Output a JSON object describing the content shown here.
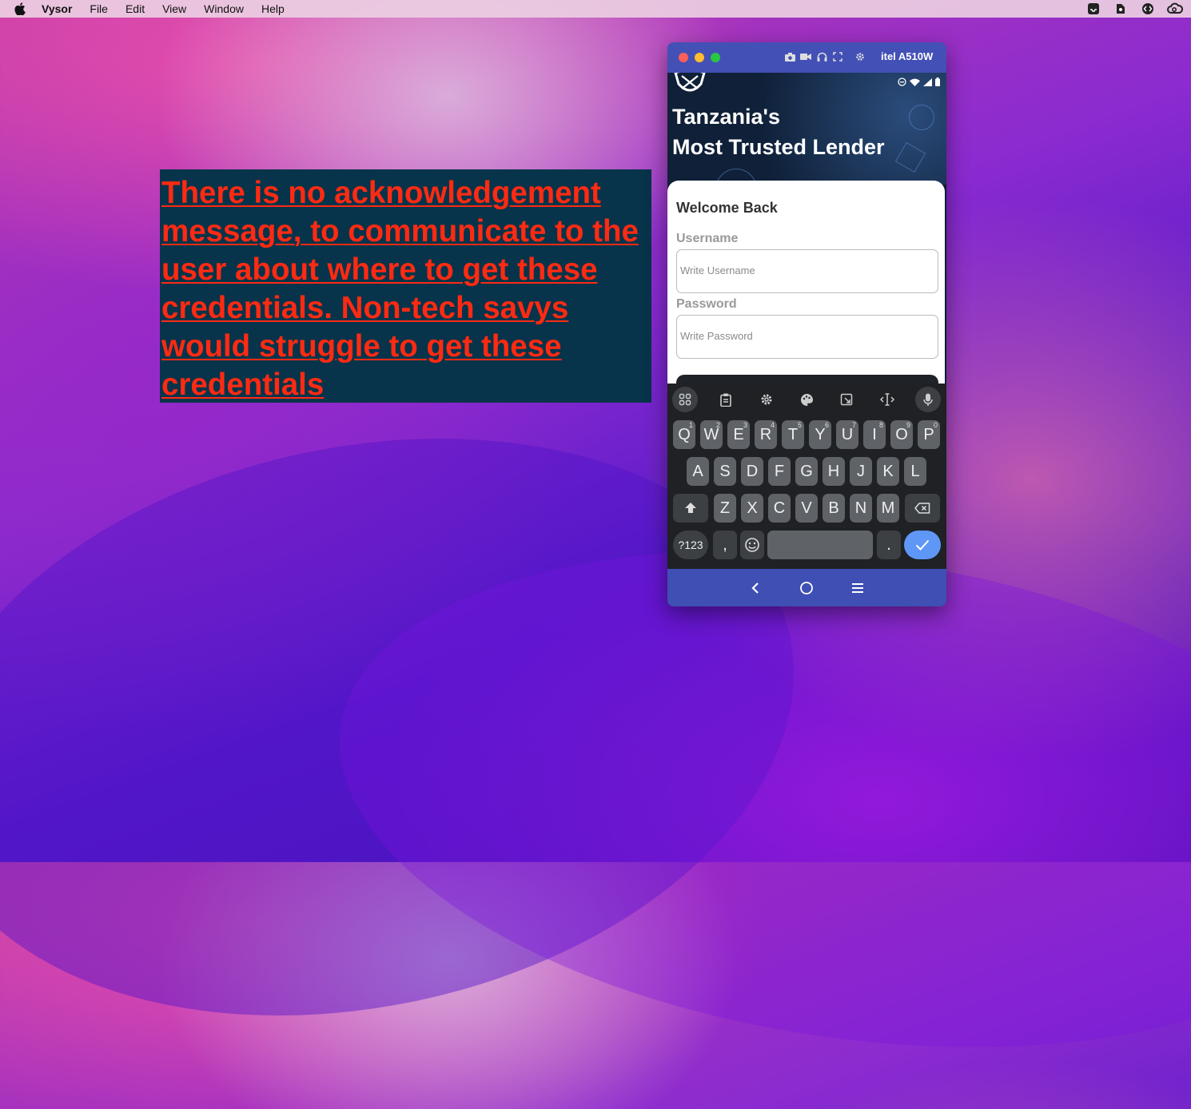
{
  "menubar": {
    "app_name": "Vysor",
    "items": [
      "File",
      "Edit",
      "View",
      "Window",
      "Help"
    ]
  },
  "annotation": {
    "text": "There is no acknowledgement message, to communicate to the user about where to get these credentials. Non-tech savys would struggle to get these credentials",
    "text_color": "#ff2a12",
    "background": "#07344a"
  },
  "vysor_window": {
    "device_name": "itel A510W",
    "app": {
      "hero_title_line1": "Tanzania's",
      "hero_title_line2": "Most Trusted Lender",
      "welcome": "Welcome Back",
      "username_label": "Username",
      "username_placeholder": "Write Username",
      "password_label": "Password",
      "password_placeholder": "Write Password"
    },
    "keyboard": {
      "row1": [
        {
          "k": "Q",
          "n": "1"
        },
        {
          "k": "W",
          "n": "2"
        },
        {
          "k": "E",
          "n": "3"
        },
        {
          "k": "R",
          "n": "4"
        },
        {
          "k": "T",
          "n": "5"
        },
        {
          "k": "Y",
          "n": "6"
        },
        {
          "k": "U",
          "n": "7"
        },
        {
          "k": "I",
          "n": "8"
        },
        {
          "k": "O",
          "n": "9"
        },
        {
          "k": "P",
          "n": "0"
        }
      ],
      "row2": [
        "A",
        "S",
        "D",
        "F",
        "G",
        "H",
        "J",
        "K",
        "L"
      ],
      "row3": [
        "Z",
        "X",
        "C",
        "V",
        "B",
        "N",
        "M"
      ],
      "symbols_key": "?123",
      "comma_key": ",",
      "period_key": "."
    },
    "accent_color": "#3f4fb4",
    "enter_color": "#5e97f6"
  }
}
